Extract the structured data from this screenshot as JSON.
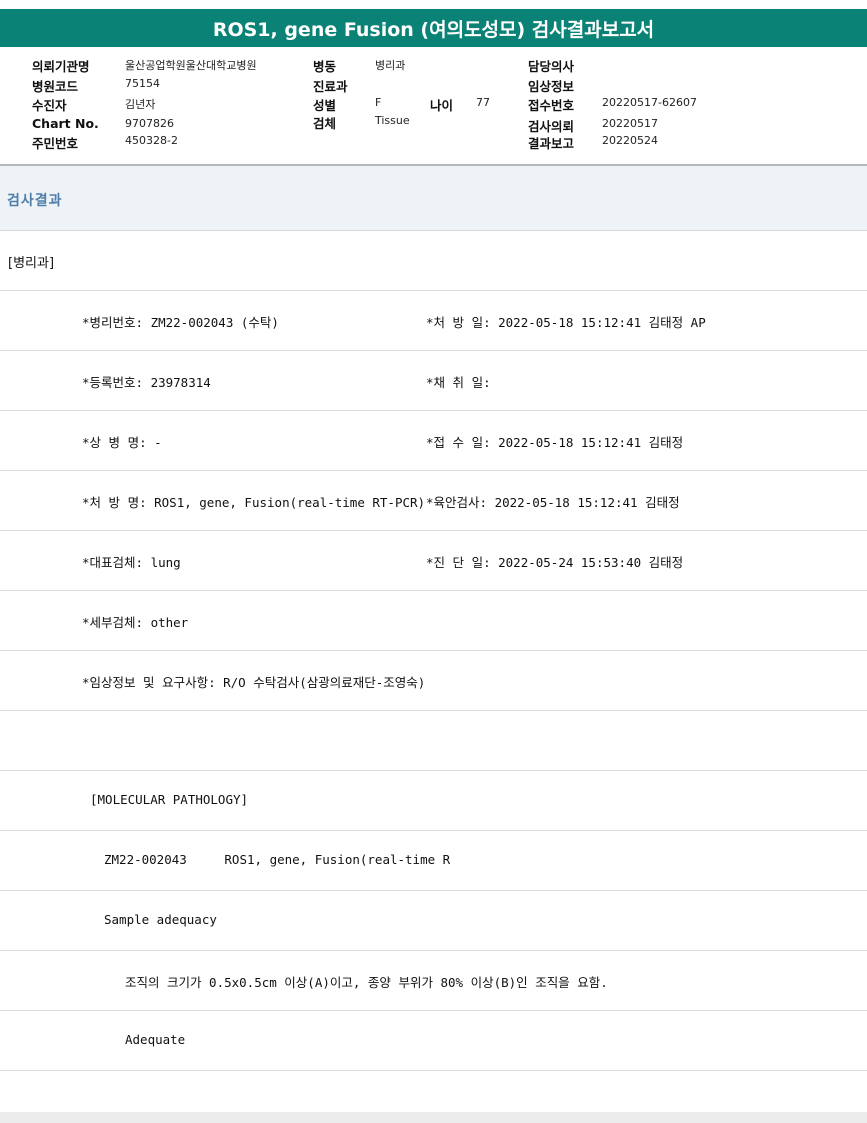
{
  "title": "ROS1, gene Fusion (여의도성모) 검사결과보고서",
  "header": {
    "hospital_label": "의뢰기관명",
    "hospital_value": "울산공업학원울산대학교병원",
    "code_label": "병원코드",
    "code_value": "75154",
    "receiver_label": "수진자",
    "receiver_value": "김년자",
    "chart_label": "Chart No.",
    "chart_value": "9707826",
    "resident_label": "주민번호",
    "resident_value": "450328-2",
    "ward_label": "병동",
    "ward_value": "병리과",
    "dept_label": "진료과",
    "dept_value": "",
    "sex_label": "성별",
    "sex_value": "F",
    "age_label": "나이",
    "age_value": "77",
    "specimen_label": "검체",
    "specimen_value": "Tissue",
    "doctor_label": "담당의사",
    "doctor_value": "",
    "clinical_label": "임상정보",
    "clinical_value": "",
    "accession_label": "접수번호",
    "accession_value": "20220517-62607",
    "request_label": "검사의뢰",
    "request_value": "20220517",
    "report_label": "결과보고",
    "report_value": "20220524"
  },
  "section": {
    "title": "검사결과"
  },
  "dept_tag": "[병리과]",
  "rows": {
    "path_no": "*병리번호: ZM22-002043 (수탁)",
    "order_date": "*처 방 일: 2022-05-18 15:12:41  김태정 AP",
    "reg_no": "*등록번호: 23978314",
    "collect_date": "*채 취 일:",
    "diagnosis": "*상 병 명: -",
    "receipt_date": "*접 수 일: 2022-05-18 15:12:41  김태정",
    "order_name": "*처 방 명: ROS1, gene, Fusion(real-time RT-PCR)",
    "gross_date": "*육안검사: 2022-05-18 15:12:41  김태정",
    "main_specimen": "*대표검체: lung",
    "diag_date": "*진 단 일: 2022-05-24 15:53:40  김태정",
    "sub_specimen": "*세부검체: other",
    "clinical_info": "*임상정보 및 요구사항: R/O 수탁검사(삼광의료재단-조영숙)",
    "mol_path": "[MOLECULAR PATHOLOGY]",
    "test_line": "ZM22-002043     ROS1, gene, Fusion(real-time R",
    "adequacy_title": "Sample adequacy",
    "adequacy_criteria": "조직의 크기가 0.5x0.5cm 이상(A)이고, 종양 부위가 80% 이상(B)인 조직을 요함.",
    "adequacy_result": "Adequate"
  }
}
